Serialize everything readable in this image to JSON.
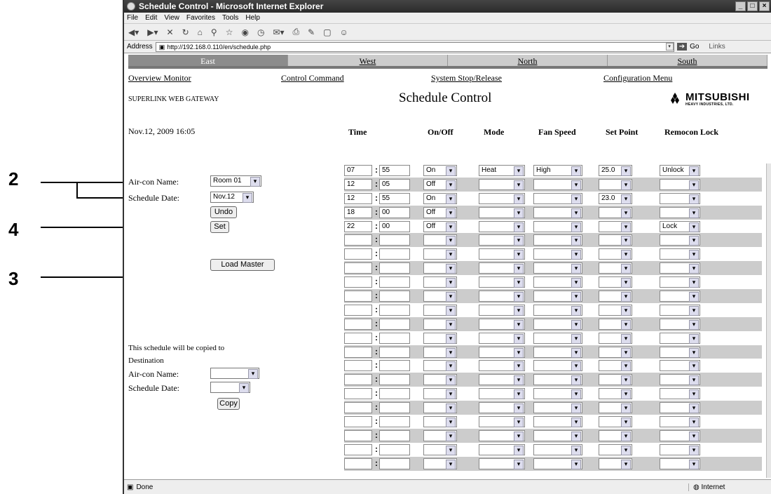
{
  "browser": {
    "title": "Schedule Control - Microsoft Internet Explorer",
    "menu": [
      "File",
      "Edit",
      "View",
      "Favorites",
      "Tools",
      "Help"
    ],
    "address_label": "Address",
    "address": "http://192.168.0.110/en/schedule.php",
    "go": "Go",
    "links": "Links",
    "status": "Done",
    "zone": "Internet"
  },
  "tabs": [
    "East",
    "West",
    "North",
    "South"
  ],
  "nav": [
    "Overview Monitor",
    "Control Command",
    "System Stop/Release",
    "Configuration Menu"
  ],
  "header": {
    "gateway": "SUPERLINK WEB GATEWAY",
    "title": "Schedule Control",
    "logo": "MITSUBISHI",
    "logo_sub": "HEAVY INDUSTRIES, LTD.",
    "datetime": "Nov.12, 2009  16:05"
  },
  "form": {
    "aircon_label": "Air-con Name:",
    "aircon_value": "Room 01",
    "date_label": "Schedule Date:",
    "date_value": "Nov.12",
    "undo": "Undo",
    "set": "Set",
    "load_master": "Load Master",
    "copy_note1": "This schedule will be copied to",
    "copy_note2": "Destination",
    "dest_aircon_label": "Air-con Name:",
    "dest_date_label": "Schedule Date:",
    "copy": "Copy"
  },
  "columns": [
    "Time",
    "On/Off",
    "Mode",
    "Fan Speed",
    "Set Point",
    "Remocon Lock"
  ],
  "rows": [
    {
      "h": "07",
      "m": "55",
      "onoff": "On",
      "mode": "Heat",
      "fan": "High",
      "set": "25.0",
      "lock": "Unlock"
    },
    {
      "h": "12",
      "m": "05",
      "onoff": "Off",
      "mode": "",
      "fan": "",
      "set": "",
      "lock": ""
    },
    {
      "h": "12",
      "m": "55",
      "onoff": "On",
      "mode": "",
      "fan": "",
      "set": "23.0",
      "lock": ""
    },
    {
      "h": "18",
      "m": "00",
      "onoff": "Off",
      "mode": "",
      "fan": "",
      "set": "",
      "lock": ""
    },
    {
      "h": "22",
      "m": "00",
      "onoff": "Off",
      "mode": "",
      "fan": "",
      "set": "",
      "lock": "Lock"
    },
    {
      "h": "",
      "m": "",
      "onoff": "",
      "mode": "",
      "fan": "",
      "set": "",
      "lock": ""
    },
    {
      "h": "",
      "m": "",
      "onoff": "",
      "mode": "",
      "fan": "",
      "set": "",
      "lock": ""
    },
    {
      "h": "",
      "m": "",
      "onoff": "",
      "mode": "",
      "fan": "",
      "set": "",
      "lock": ""
    },
    {
      "h": "",
      "m": "",
      "onoff": "",
      "mode": "",
      "fan": "",
      "set": "",
      "lock": ""
    },
    {
      "h": "",
      "m": "",
      "onoff": "",
      "mode": "",
      "fan": "",
      "set": "",
      "lock": ""
    },
    {
      "h": "",
      "m": "",
      "onoff": "",
      "mode": "",
      "fan": "",
      "set": "",
      "lock": ""
    },
    {
      "h": "",
      "m": "",
      "onoff": "",
      "mode": "",
      "fan": "",
      "set": "",
      "lock": ""
    },
    {
      "h": "",
      "m": "",
      "onoff": "",
      "mode": "",
      "fan": "",
      "set": "",
      "lock": ""
    },
    {
      "h": "",
      "m": "",
      "onoff": "",
      "mode": "",
      "fan": "",
      "set": "",
      "lock": ""
    },
    {
      "h": "",
      "m": "",
      "onoff": "",
      "mode": "",
      "fan": "",
      "set": "",
      "lock": ""
    },
    {
      "h": "",
      "m": "",
      "onoff": "",
      "mode": "",
      "fan": "",
      "set": "",
      "lock": ""
    },
    {
      "h": "",
      "m": "",
      "onoff": "",
      "mode": "",
      "fan": "",
      "set": "",
      "lock": ""
    },
    {
      "h": "",
      "m": "",
      "onoff": "",
      "mode": "",
      "fan": "",
      "set": "",
      "lock": ""
    },
    {
      "h": "",
      "m": "",
      "onoff": "",
      "mode": "",
      "fan": "",
      "set": "",
      "lock": ""
    },
    {
      "h": "",
      "m": "",
      "onoff": "",
      "mode": "",
      "fan": "",
      "set": "",
      "lock": ""
    },
    {
      "h": "",
      "m": "",
      "onoff": "",
      "mode": "",
      "fan": "",
      "set": "",
      "lock": ""
    },
    {
      "h": "",
      "m": "",
      "onoff": "",
      "mode": "",
      "fan": "",
      "set": "",
      "lock": ""
    }
  ],
  "callouts": [
    "2",
    "4",
    "3"
  ],
  "colors": {
    "active_tab": "#8c8c8c",
    "tab": "#cccccc",
    "row_alt": "#cccccc"
  }
}
